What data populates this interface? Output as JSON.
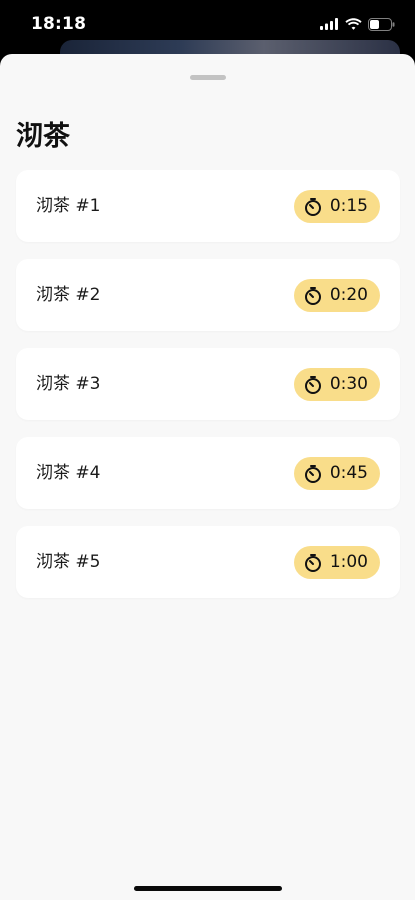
{
  "status_bar": {
    "time": "18:18",
    "icons": [
      "cellular-signal-icon",
      "wifi-icon",
      "battery-icon"
    ]
  },
  "sheet": {
    "title": "沏茶",
    "items": [
      {
        "label": "沏茶 #1",
        "timer": "0:15"
      },
      {
        "label": "沏茶 #2",
        "timer": "0:20"
      },
      {
        "label": "沏茶 #3",
        "timer": "0:30"
      },
      {
        "label": "沏茶 #4",
        "timer": "0:45"
      },
      {
        "label": "沏茶 #5",
        "timer": "1:00"
      }
    ]
  },
  "colors": {
    "sheet_background": "#f8f8f8",
    "card_background": "#ffffff",
    "badge_background": "#f9dd8a",
    "status_bar_background": "#000000"
  },
  "icons": {
    "timer": "timer-icon"
  }
}
